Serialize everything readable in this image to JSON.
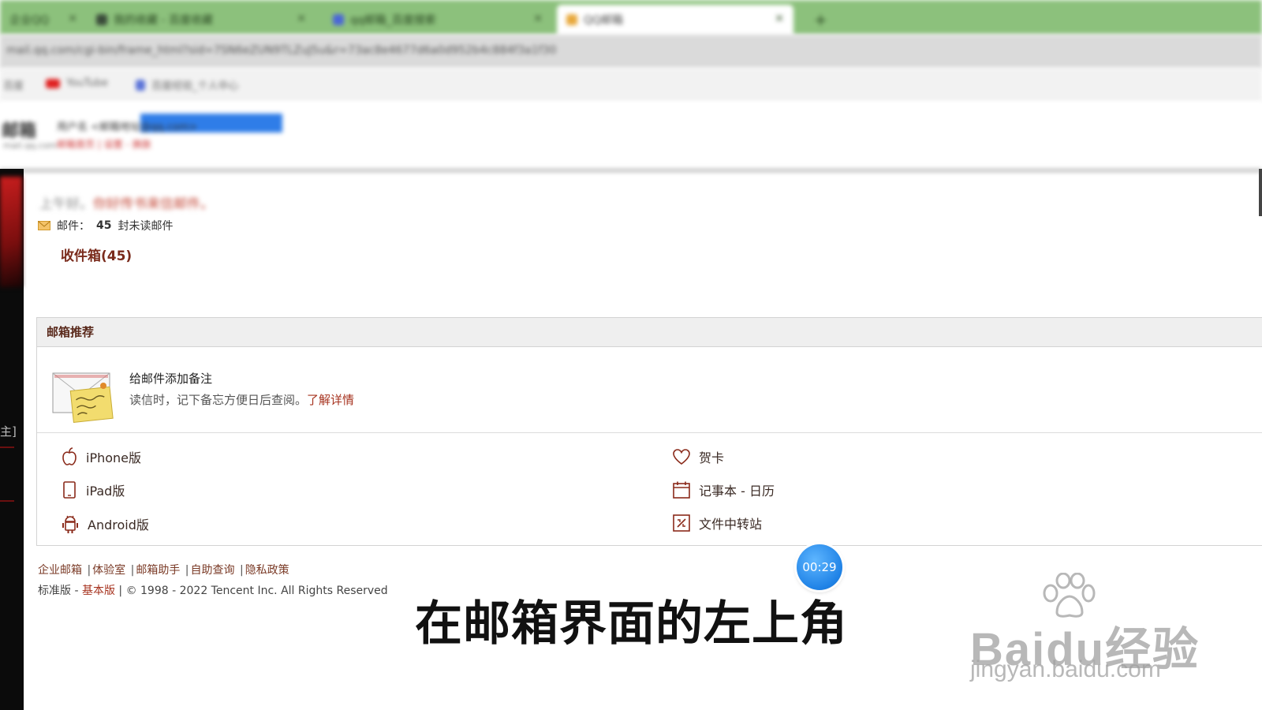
{
  "browser": {
    "tabs": [
      {
        "label": "企业QQ"
      },
      {
        "label": "我的收藏 - 百度收藏"
      },
      {
        "label": "qq邮箱_百度搜索"
      },
      {
        "label": "QQ邮箱"
      }
    ],
    "new_tab": "+",
    "url": "mail.qq.com/cgi-bin/frame_html?sid=7SN6eZUN9TLZuJ5u&r=73ac8e4677d6a0d952b4c884f3a1f30",
    "bookmarks": [
      {
        "label": "百度"
      },
      {
        "label": "YouTube"
      },
      {
        "label": "百度经验_个人中心"
      }
    ]
  },
  "mail_header": {
    "logo": "邮箱",
    "logo_sub": "mail.qq.com",
    "account": "用户名 <邮箱地址@qq.com>",
    "links": "邮箱首页 | 设置 - 换肤"
  },
  "main": {
    "greeting": "上午好。",
    "greeting_quote": "你好传书来信邮件。",
    "mail_label": "邮件：",
    "unread_count": "45",
    "unread_suffix": "封未读邮件",
    "inbox_link": "收件箱(45)"
  },
  "recommend": {
    "title": "邮箱推荐",
    "promo_title": "给邮件添加备注",
    "promo_desc": "读信时，记下备忘方便日后查阅。",
    "promo_link": "了解详情",
    "features_left": [
      {
        "label": "iPhone版",
        "icon": "apple-icon"
      },
      {
        "label": "iPad版",
        "icon": "tablet-icon"
      },
      {
        "label": "Android版",
        "icon": "android-icon"
      }
    ],
    "features_right": [
      {
        "label": "贺卡",
        "icon": "heart-icon"
      },
      {
        "label": "记事本 - 日历",
        "icon": "calendar-icon"
      },
      {
        "label": "文件中转站",
        "icon": "file-transfer-icon"
      }
    ]
  },
  "footer": {
    "links": [
      "企业邮箱",
      "体验室",
      "邮箱助手",
      "自助查询",
      "隐私政策"
    ],
    "separator": "|",
    "version_std": "标准版",
    "version_dash": " - ",
    "version_basic": "基本版",
    "copyright": " | © 1998 - 2022 Tencent Inc. All Rights Reserved"
  },
  "overlay": {
    "timer": "00:29",
    "subtitle": "在邮箱界面的左上角",
    "watermark_text": "Baidu经验",
    "watermark_url": "jingyan.baidu.com"
  },
  "colors": {
    "tabstrip": "#8cc17c",
    "accent_link": "#a6321e",
    "inbox_link": "#7a2b1c",
    "timer_blue": "#1f82e6"
  }
}
